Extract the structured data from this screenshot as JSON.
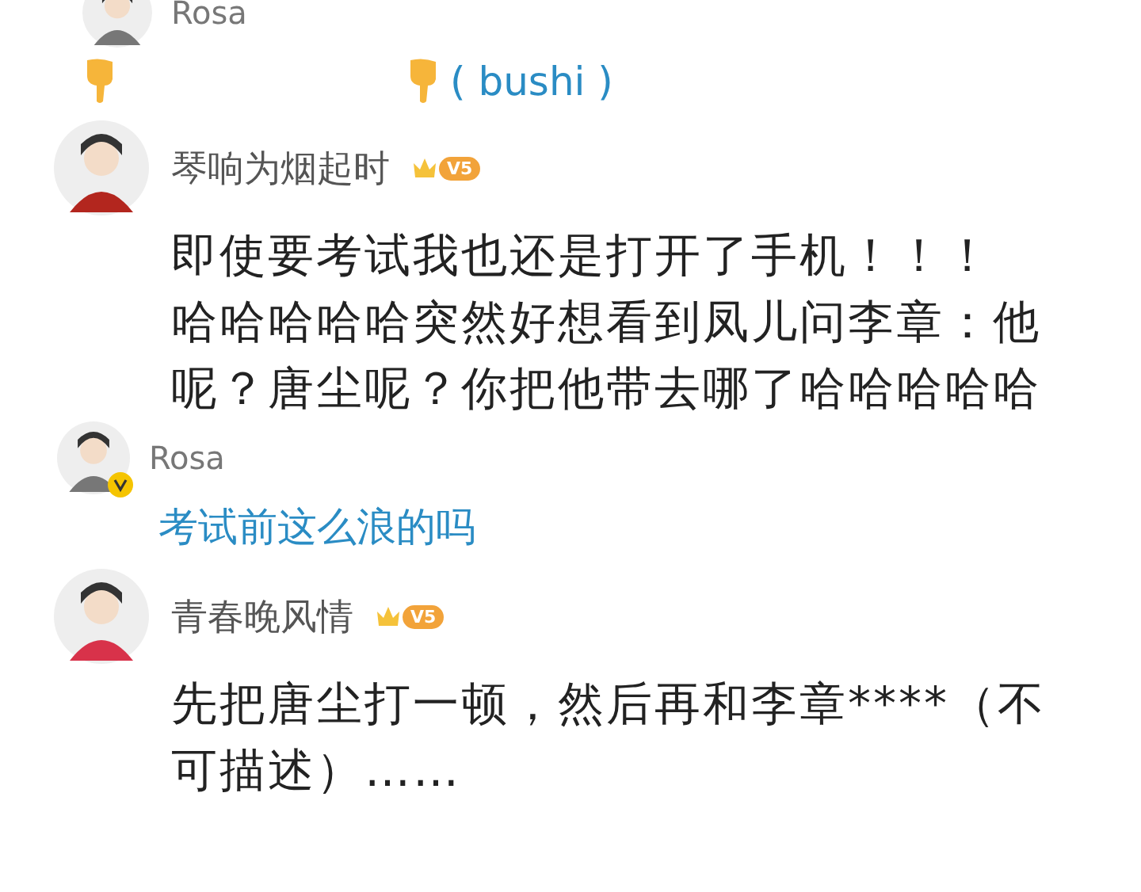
{
  "items": [
    {
      "kind": "reply",
      "author": "Rosa",
      "verified": false,
      "pointing": true,
      "text": "( bushi )"
    },
    {
      "kind": "comment",
      "author": "琴响为烟起时",
      "badge": "V5",
      "paragraphs": [
        "即使要考试我也还是打开了手机！！！",
        "哈哈哈哈哈突然好想看到凤儿问李章：他呢？唐尘呢？你把他带去哪了哈哈哈哈哈"
      ]
    },
    {
      "kind": "reply",
      "author": "Rosa",
      "verified": true,
      "pointing": false,
      "text": "考试前这么浪的吗"
    },
    {
      "kind": "comment",
      "author": "青春晚风情",
      "badge": "V5",
      "paragraphs": [
        "先把唐尘打一顿，然后再和李章****（不可描述）……"
      ]
    }
  ]
}
